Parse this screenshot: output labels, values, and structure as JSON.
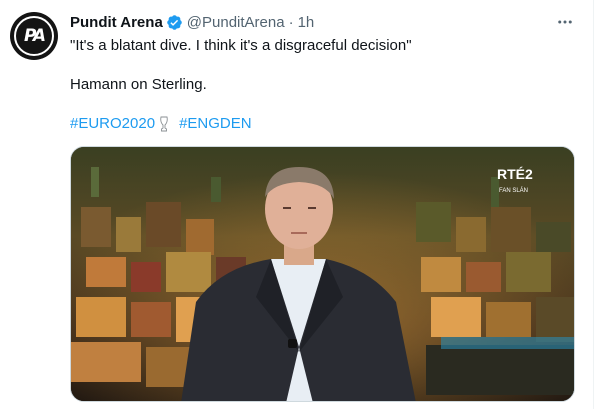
{
  "account": {
    "display_name": "Pundit Arena",
    "handle": "@PunditArena",
    "separator": "·",
    "time": "1h",
    "avatar_text": "PA"
  },
  "tweet": {
    "line1": "\"It's a blatant dive. I think it's a disgraceful decision\"",
    "line2": "Hamann on Sterling.",
    "hashtags": [
      "#EURO2020",
      "#ENGDEN"
    ]
  },
  "media": {
    "broadcaster_logo": "RTÉ2",
    "broadcaster_sub": "FAN SLÁN"
  },
  "colors": {
    "link": "#1d9bf0",
    "verified": "#1d9bf0",
    "secondary_text": "#536471"
  },
  "icons": {
    "verified": "verified-badge-icon",
    "more": "more-options-icon",
    "trophy": "trophy-emoji-icon"
  }
}
